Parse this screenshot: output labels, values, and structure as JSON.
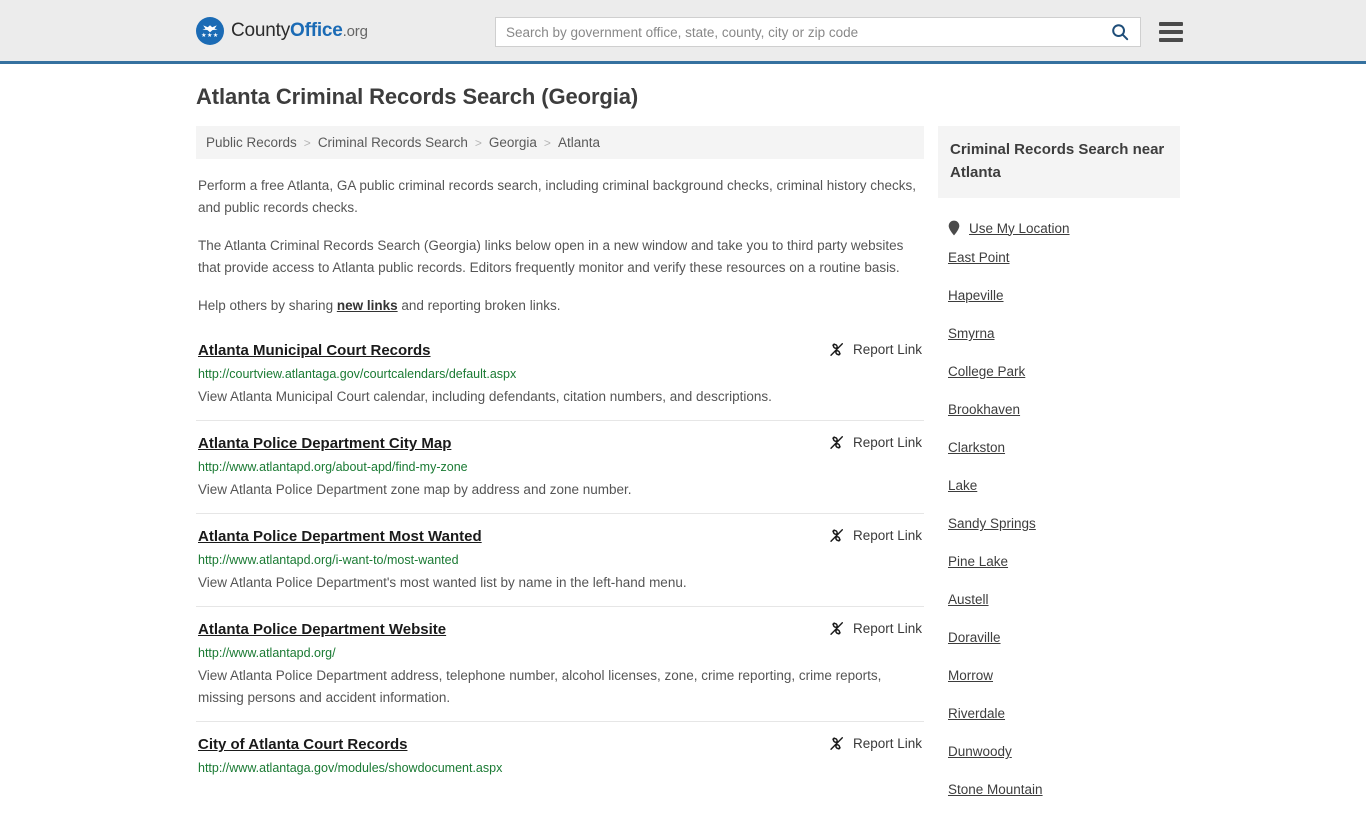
{
  "header": {
    "logo": {
      "part1": "County",
      "part2": "Office",
      "part3": ".org",
      "icon": "eagle-seal-icon",
      "stars": "★★★"
    },
    "search": {
      "placeholder": "Search by government office, state, county, city or zip code",
      "value": "",
      "search_icon": "search-icon"
    },
    "menu_icon": "hamburger-menu-icon",
    "accent_color": "#35719f",
    "background_color": "#ececec"
  },
  "page": {
    "title": "Atlanta Criminal Records Search (Georgia)"
  },
  "breadcrumb": {
    "separator": ">",
    "items": [
      {
        "label": "Public Records"
      },
      {
        "label": "Criminal Records Search"
      },
      {
        "label": "Georgia"
      },
      {
        "label": "Atlanta"
      }
    ]
  },
  "intro": {
    "paragraph1": "Perform a free Atlanta, GA public criminal records search, including criminal background checks, criminal history checks, and public records checks.",
    "paragraph2": "The Atlanta Criminal Records Search (Georgia) links below open in a new window and take you to third party websites that provide access to Atlanta public records. Editors frequently monitor and verify these resources on a routine basis.",
    "paragraph3_before": "Help others by sharing ",
    "paragraph3_link": "new links",
    "paragraph3_after": " and reporting broken links."
  },
  "results": {
    "report_label": "Report Link",
    "report_icon": "broken-link-icon",
    "items": [
      {
        "title": "Atlanta Municipal Court Records",
        "url": "http://courtview.atlantaga.gov/courtcalendars/default.aspx",
        "description": "View Atlanta Municipal Court calendar, including defendants, citation numbers, and descriptions."
      },
      {
        "title": "Atlanta Police Department City Map",
        "url": "http://www.atlantapd.org/about-apd/find-my-zone",
        "description": "View Atlanta Police Department zone map by address and zone number."
      },
      {
        "title": "Atlanta Police Department Most Wanted",
        "url": "http://www.atlantapd.org/i-want-to/most-wanted",
        "description": "View Atlanta Police Department's most wanted list by name in the left-hand menu."
      },
      {
        "title": "Atlanta Police Department Website",
        "url": "http://www.atlantapd.org/",
        "description": "View Atlanta Police Department address, telephone number, alcohol licenses, zone, crime reporting, crime reports, missing persons and accident information."
      },
      {
        "title": "City of Atlanta Court Records",
        "url": "http://www.atlantaga.gov/modules/showdocument.aspx",
        "description": ""
      }
    ]
  },
  "sidebar": {
    "heading": "Criminal Records Search near Atlanta",
    "use_my_location": {
      "label": "Use My Location",
      "icon": "map-pin-icon"
    },
    "cities": [
      {
        "label": "East Point"
      },
      {
        "label": "Hapeville"
      },
      {
        "label": "Smyrna"
      },
      {
        "label": "College Park"
      },
      {
        "label": "Brookhaven"
      },
      {
        "label": "Clarkston"
      },
      {
        "label": "Lake"
      },
      {
        "label": "Sandy Springs"
      },
      {
        "label": "Pine Lake"
      },
      {
        "label": "Austell"
      },
      {
        "label": "Doraville"
      },
      {
        "label": "Morrow"
      },
      {
        "label": "Riverdale"
      },
      {
        "label": "Dunwoody"
      },
      {
        "label": "Stone Mountain"
      }
    ]
  },
  "colors": {
    "link_green": "#1a7a33",
    "brand_blue": "#1b6bb5",
    "header_rule": "#35719f"
  }
}
